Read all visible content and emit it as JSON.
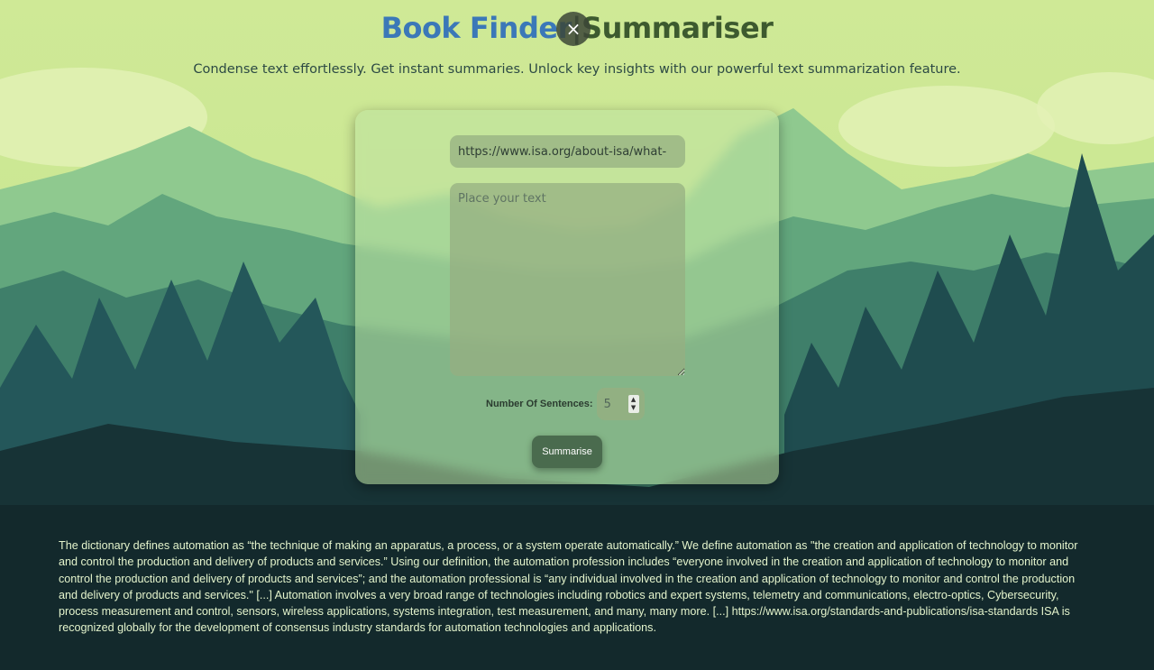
{
  "header": {
    "title_part1": "Book Finder",
    "title_sep": "|",
    "title_part2": "Summariser",
    "close_glyph": "×",
    "subtitle": "Condense text effortlessly. Get instant summaries. Unlock key insights with our powerful text summarization feature."
  },
  "form": {
    "url_value": "https://www.isa.org/about-isa/what-",
    "text_placeholder": "Place your text",
    "sentences_label": "Number Of Sentences:",
    "sentences_value": "5",
    "submit_label": "Summarise"
  },
  "result": {
    "summary": "The dictionary defines automation as “the technique of making an apparatus, a process, or a system operate automatically.” We define automation as \"the creation and application of technology to monitor and control the production and delivery of products and services.” Using our definition, the automation profession includes “everyone involved in the creation and application of technology to monitor and control the production and delivery of products and services”; and the automation professional is “any individual involved in the creation and application of technology to monitor and control the production and delivery of products and services.\" [...] Automation involves a very broad range of technologies including robotics and expert systems, telemetry and communications, electro-optics, Cybersecurity, process measurement and control, sensors, wireless applications, systems integration, test measurement, and many, many more. [...] https://www.isa.org/standards-and-publications/isa-standards ISA is recognized globally for the development of consensus industry standards for automation technologies and applications."
  },
  "icons": {
    "close": "close-icon",
    "spinner_up": "chevron-up-icon",
    "spinner_down": "chevron-down-icon"
  },
  "colors": {
    "title_blue": "#3b78b8",
    "title_green": "#3d5a2f",
    "button": "#4a6b4e",
    "summary_text": "#e4f4cc"
  }
}
